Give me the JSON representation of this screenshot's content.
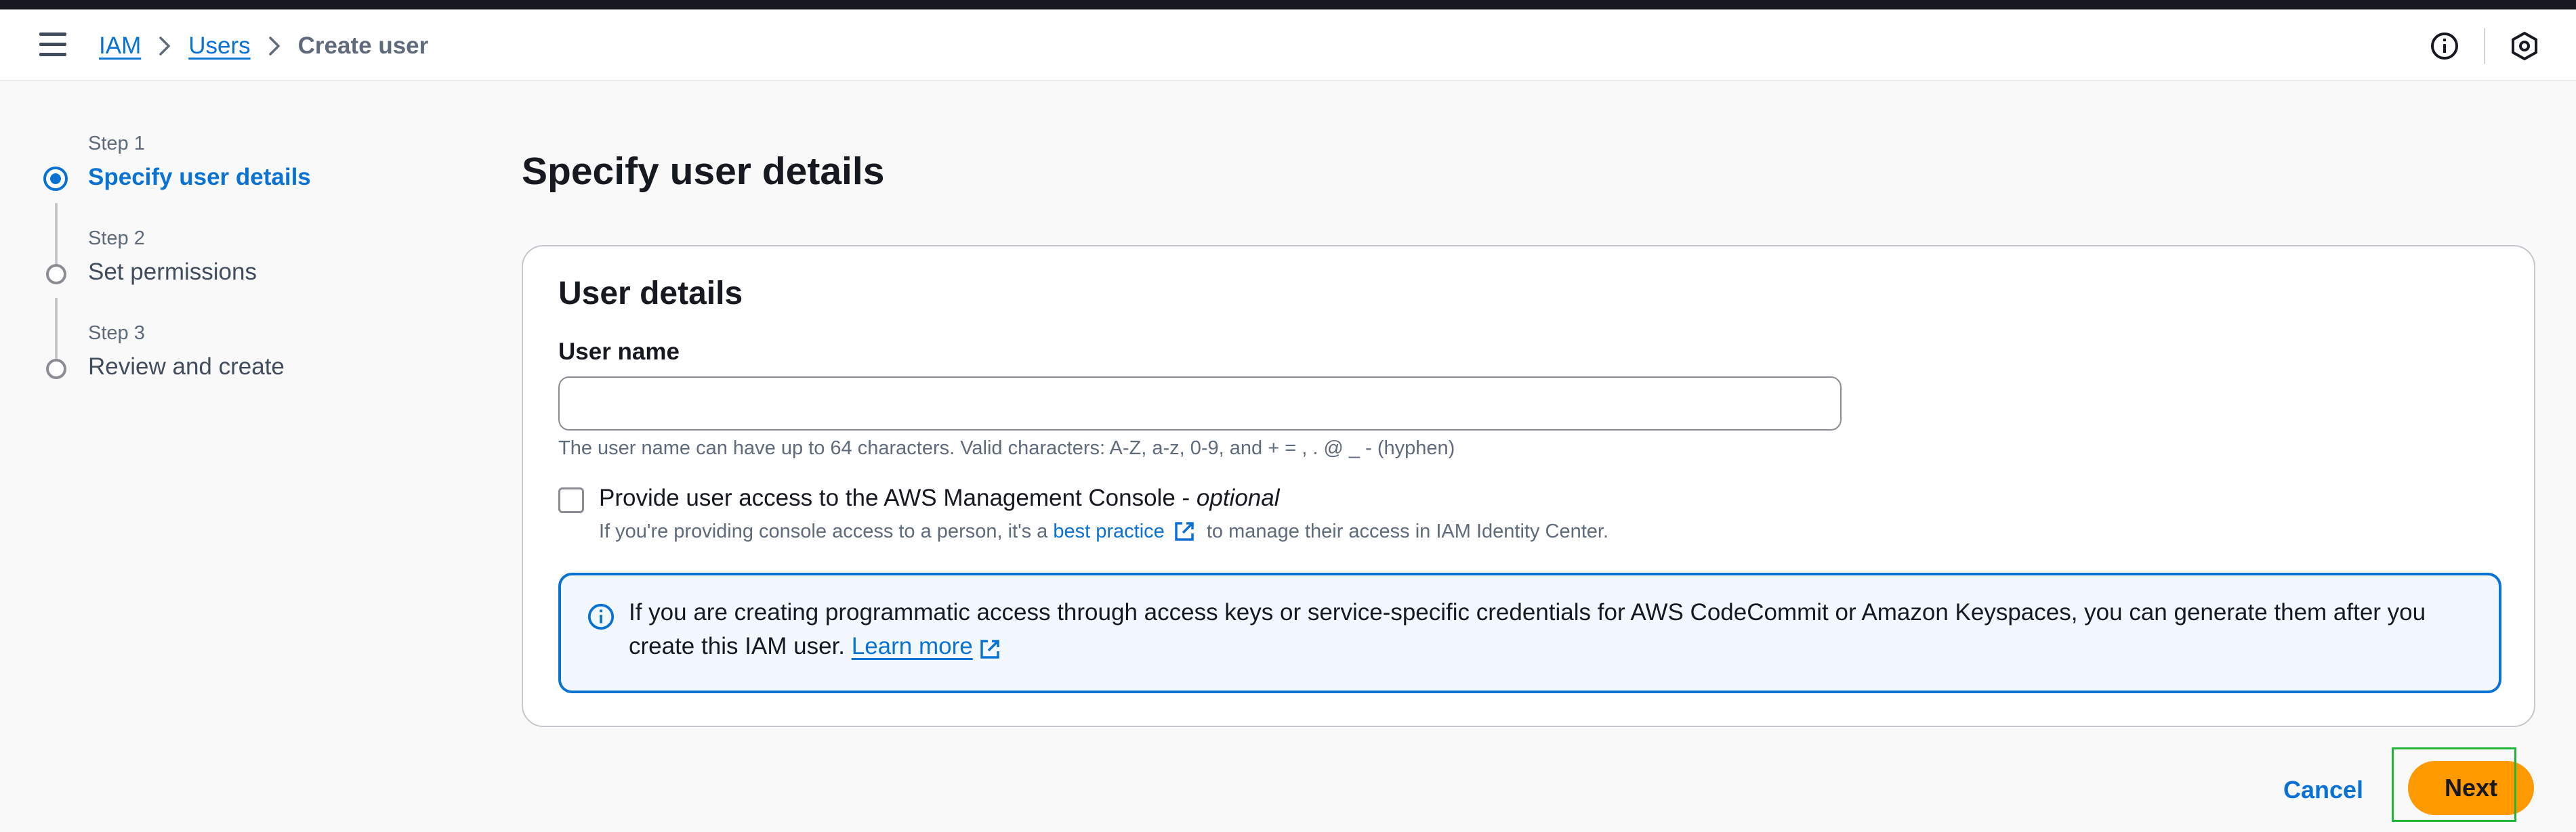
{
  "breadcrumb": {
    "items": [
      "IAM",
      "Users"
    ],
    "current": "Create user"
  },
  "header_icons": [
    "info-icon",
    "settings-hex-icon"
  ],
  "steps": [
    {
      "num": "Step 1",
      "title": "Specify user details",
      "state": "active"
    },
    {
      "num": "Step 2",
      "title": "Set permissions",
      "state": "pending"
    },
    {
      "num": "Step 3",
      "title": "Review and create",
      "state": "pending"
    }
  ],
  "page": {
    "title": "Specify user details"
  },
  "card": {
    "title": "User details",
    "username_label": "User name",
    "username_value": "",
    "username_hint": "The user name can have up to 64 characters. Valid characters: A-Z, a-z, 0-9, and + = , . @ _ - (hyphen)",
    "console_checkbox_label": "Provide user access to the AWS Management Console - ",
    "console_checkbox_optional": "optional",
    "console_checked": false,
    "console_hint_pre": "If you're providing console access to a person, it's a ",
    "console_hint_link": "best practice",
    "console_hint_post": " to manage their access in IAM Identity Center."
  },
  "info": {
    "text": "If you are creating programmatic access through access keys or service-specific credentials for AWS CodeCommit or Amazon Keyspaces, you can generate them after you create this IAM user. ",
    "link": "Learn more"
  },
  "actions": {
    "cancel": "Cancel",
    "next": "Next"
  },
  "colors": {
    "accent": "#0972d3",
    "primary_button": "#ff9900",
    "highlight": "#1eb53a"
  }
}
